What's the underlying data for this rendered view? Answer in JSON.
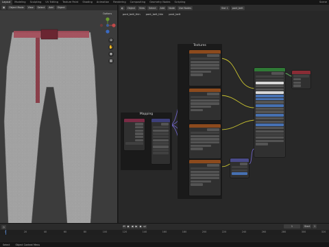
{
  "topbar": {
    "tabs": [
      "Layout",
      "Modeling",
      "Sculpting",
      "UV Editing",
      "Texture Paint",
      "Shading",
      "Animation",
      "Rendering",
      "Compositing",
      "Geometry Nodes",
      "Scripting"
    ],
    "active_tab": "Layout",
    "scene_label": "Scene"
  },
  "viewport": {
    "mode": "Object Mode",
    "view_menu": [
      "View",
      "Select",
      "Add",
      "Object"
    ],
    "options_label": "Options",
    "gizmo_axes": [
      "X",
      "Y",
      "Z"
    ]
  },
  "node_editor": {
    "header": {
      "editor_type": "Object",
      "menus": [
        "View",
        "Select",
        "Add",
        "Node"
      ],
      "use_nodes_label": "Use Nodes",
      "slot_label": "Slot 1",
      "material_name": "pant_belt"
    },
    "breadcrumb": [
      "pant_belt_thin",
      "pant_belt_thin",
      "pant_belt"
    ],
    "frames": {
      "textures": "Textures",
      "mapping": "Mapping"
    }
  },
  "timeline": {
    "ticks": [
      "0",
      "20",
      "40",
      "60",
      "80",
      "100",
      "120",
      "140",
      "160",
      "180",
      "200",
      "220",
      "240",
      "260",
      "280",
      "300",
      "320"
    ],
    "current_frame": "1",
    "start_label": "Start",
    "start_value": "1",
    "end_value": "250"
  },
  "statusbar": {
    "select_label": "Select",
    "context_menu_label": "Object Context Menu"
  },
  "colors": {
    "texture_header": "#8c4a1d",
    "mapping_header_coord": "#7a2b45",
    "mapping_header": "#3d3f79",
    "bsdf_header": "#2f7a36",
    "output_header": "#8a2c35",
    "normal_header": "#4a4b8a",
    "wire_yellow": "#c7c12f",
    "wire_purple": "#6f63c6",
    "wire_blue": "#5b76c4"
  }
}
